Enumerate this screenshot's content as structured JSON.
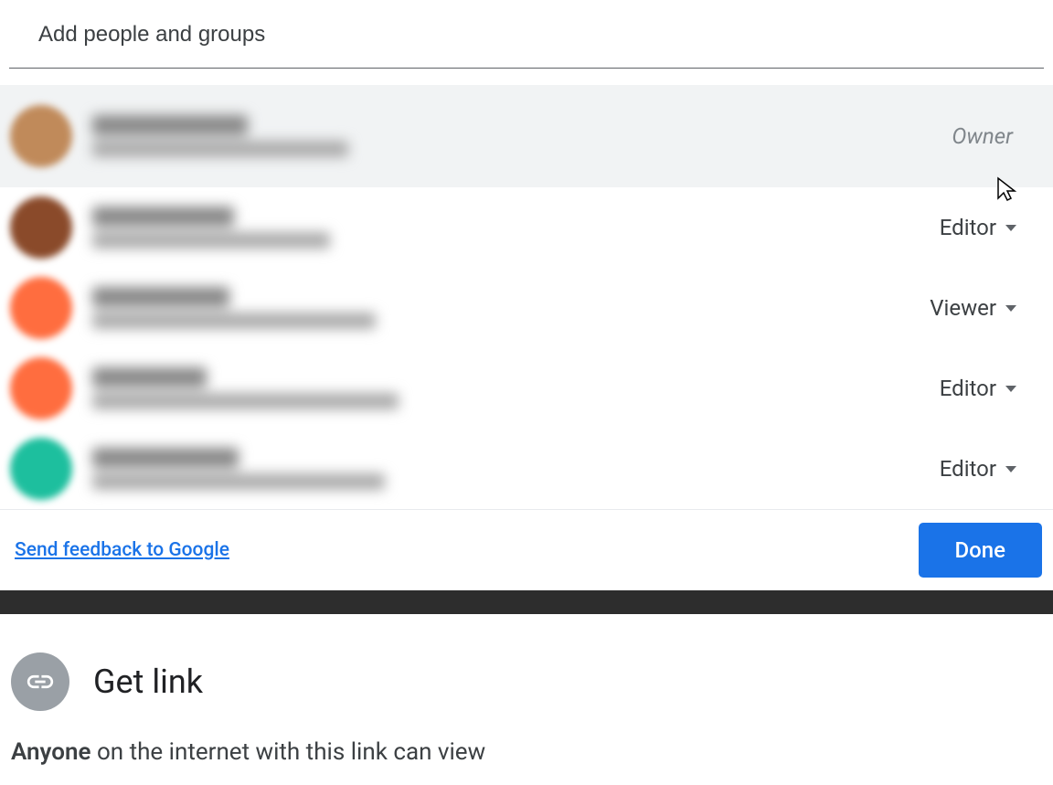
{
  "input": {
    "placeholder": "Add people and groups"
  },
  "people": [
    {
      "role": "Owner",
      "isOwner": true,
      "avatarColor": "#c08a5a",
      "nameW": 170,
      "emailW": 280
    },
    {
      "role": "Editor",
      "isOwner": false,
      "avatarColor": "#8a4a2a",
      "nameW": 155,
      "emailW": 260
    },
    {
      "role": "Viewer",
      "isOwner": false,
      "avatarColor": "#ff6d3f",
      "nameW": 150,
      "emailW": 310
    },
    {
      "role": "Editor",
      "isOwner": false,
      "avatarColor": "#ff6d3f",
      "nameW": 125,
      "emailW": 335
    },
    {
      "role": "Editor",
      "isOwner": false,
      "avatarColor": "#1dbf9e",
      "nameW": 160,
      "emailW": 320
    }
  ],
  "footer": {
    "feedback": "Send feedback to Google",
    "done": "Done"
  },
  "getLink": {
    "title": "Get link",
    "desc_bold": "Anyone",
    "desc_rest": " on the internet with this link can view"
  }
}
